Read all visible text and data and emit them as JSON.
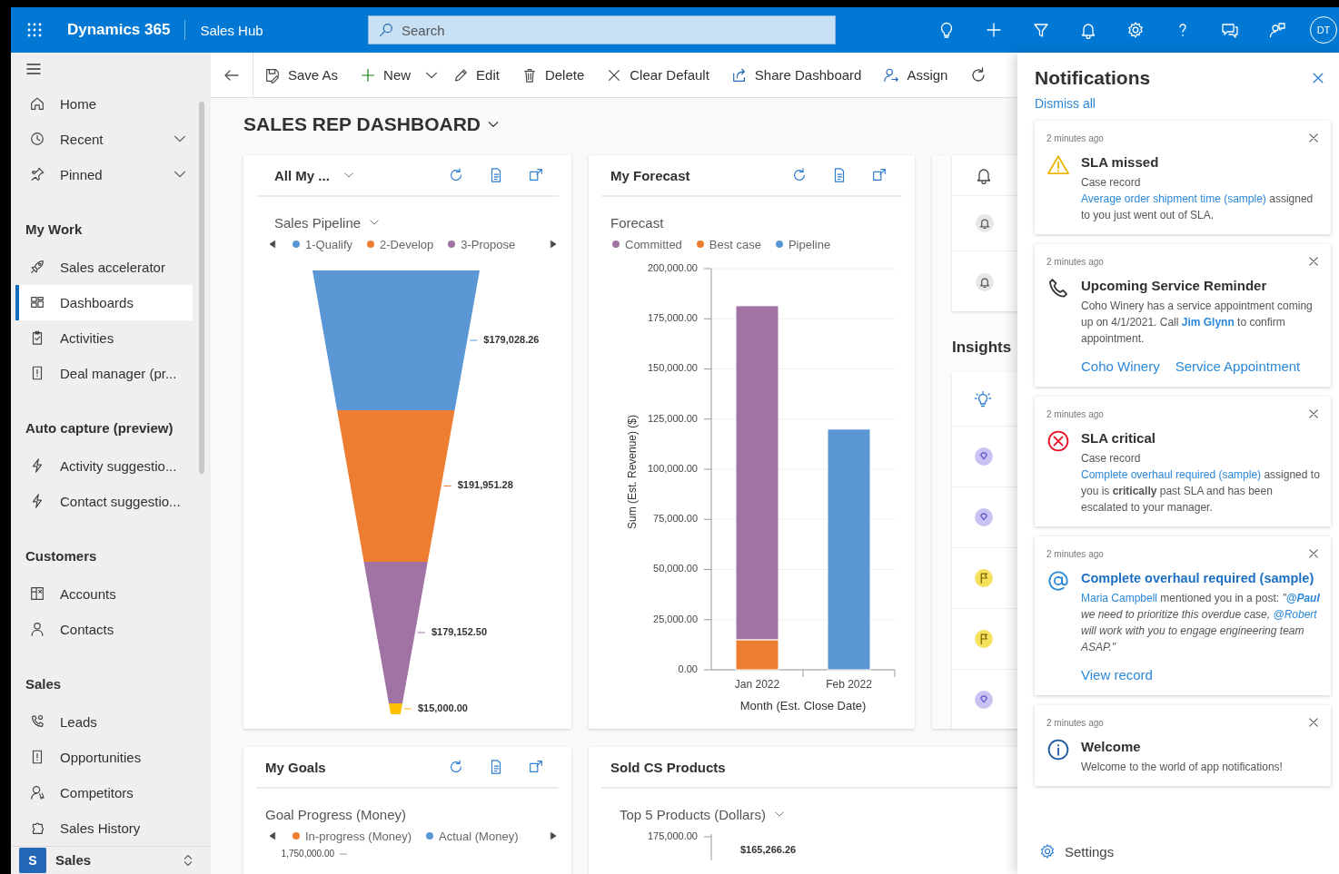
{
  "app_bar": {
    "app_name": "Dynamics 365",
    "area": "Sales Hub",
    "search": {
      "placeholder": "Search"
    },
    "avatar": "DT"
  },
  "nav": {
    "groups": [
      {
        "items": [
          {
            "label": "Home",
            "kind": "link",
            "selected": false
          },
          {
            "label": "Recent",
            "kind": "flyout",
            "selected": false
          },
          {
            "label": "Pinned",
            "kind": "flyout",
            "selected": false
          }
        ]
      },
      {
        "title": "My Work",
        "items": [
          {
            "label": "Sales accelerator",
            "kind": "link",
            "selected": false
          },
          {
            "label": "Dashboards",
            "kind": "link",
            "selected": true
          },
          {
            "label": "Activities",
            "kind": "link",
            "selected": false
          },
          {
            "label": "Deal manager (pr...",
            "kind": "link",
            "selected": false
          }
        ]
      },
      {
        "title": "Auto capture (preview)",
        "items": [
          {
            "label": "Activity suggestio...",
            "kind": "link",
            "selected": false
          },
          {
            "label": "Contact suggestio...",
            "kind": "link",
            "selected": false
          }
        ]
      },
      {
        "title": "Customers",
        "items": [
          {
            "label": "Accounts",
            "kind": "link",
            "selected": false
          },
          {
            "label": "Contacts",
            "kind": "link",
            "selected": false
          }
        ]
      },
      {
        "title": "Sales",
        "items": [
          {
            "label": "Leads",
            "kind": "link",
            "selected": false
          },
          {
            "label": "Opportunities",
            "kind": "link",
            "selected": false
          },
          {
            "label": "Competitors",
            "kind": "link",
            "selected": false
          },
          {
            "label": "Sales History",
            "kind": "link",
            "selected": false
          }
        ]
      }
    ],
    "area_switcher": {
      "badge": "S",
      "label": "Sales"
    }
  },
  "command_bar": [
    {
      "label": "Save As",
      "kind": "button"
    },
    {
      "label": "New",
      "kind": "split"
    },
    {
      "label": "Edit",
      "kind": "button"
    },
    {
      "label": "Delete",
      "kind": "button"
    },
    {
      "label": "Clear Default",
      "kind": "button"
    },
    {
      "label": "Share Dashboard",
      "kind": "button"
    },
    {
      "label": "Assign",
      "kind": "button"
    }
  ],
  "dashboard": {
    "title": "SALES REP DASHBOARD",
    "cards": [
      {
        "kind": "funnel",
        "title": "All My ...",
        "view_menu": true,
        "toolbar": true,
        "chart_title": "Sales Pipeline",
        "chart_menu": true,
        "pager": true,
        "legend": [
          {
            "label": "1-Qualify",
            "color": "#5b97d5"
          },
          {
            "label": "2-Develop",
            "color": "#ed7d31"
          },
          {
            "label": "3-Propose",
            "color": "#a173a5"
          }
        ],
        "segments": [
          {
            "label": "$179,028.26",
            "color": "#5b97d5"
          },
          {
            "label": "$191,951.28",
            "color": "#ed7d31"
          },
          {
            "label": "$179,152.50",
            "color": "#a173a5"
          },
          {
            "label": "$15,000.00",
            "color": "#ffc000"
          }
        ]
      },
      {
        "kind": "bar",
        "title": "My Forecast",
        "view_menu": false,
        "toolbar": true,
        "chart_menu": false,
        "pager": false,
        "chart_data": {
          "type": "bar",
          "title": "Forecast",
          "stacked": true,
          "grid": true,
          "xlabel": "Month (Est. Close Date)",
          "ylabel": "Sum (Est. Revenue) ($)",
          "categories": [
            "Jan 2022",
            "Feb 2022"
          ],
          "series": [
            {
              "name": "Committed",
              "color": "#a173a5",
              "values": [
                166500,
                null
              ]
            },
            {
              "name": "Best case",
              "color": "#ed7d31",
              "values": [
                15000,
                null
              ]
            },
            {
              "name": "Pipeline",
              "color": "#5b97d5",
              "values": [
                null,
                120000
              ]
            }
          ],
          "ylim": [
            0,
            200000
          ],
          "yticks": [
            {
              "value": 0,
              "label": "0.00"
            },
            {
              "value": 25000,
              "label": "25,000.00"
            },
            {
              "value": 50000,
              "label": "50,000.00"
            },
            {
              "value": 75000,
              "label": "75,000.00"
            },
            {
              "value": 100000,
              "label": "100,000.00"
            },
            {
              "value": 125000,
              "label": "125,000.00"
            },
            {
              "value": 150000,
              "label": "150,000.00"
            },
            {
              "value": 175000,
              "label": "175,000.00"
            },
            {
              "value": 200000,
              "label": "200,000.00"
            }
          ]
        }
      },
      {
        "kind": "insights",
        "heading": "Insights",
        "insights": [
          {
            "kind": "diamond"
          },
          {
            "kind": "diamond"
          },
          {
            "kind": "flag"
          },
          {
            "kind": "flag"
          },
          {
            "kind": "diamond"
          }
        ]
      },
      {
        "kind": "goals",
        "title": "My Goals",
        "view_menu": false,
        "toolbar": true,
        "chart_title": "Goal Progress (Money)",
        "chart_menu": false,
        "pager": true,
        "legend": [
          {
            "label": "In-progress (Money)",
            "color": "#ed7d31"
          },
          {
            "label": "Actual (Money)",
            "color": "#5b97d5"
          }
        ],
        "axis_tick": "1,750,000.00"
      },
      {
        "kind": "products",
        "title": "Sold CS Products",
        "view_menu": false,
        "toolbar": false,
        "chart_title": "Top 5 Products (Dollars)",
        "chart_menu": true,
        "axis_tick": "175,000.00",
        "value_label": "$165,266.26"
      }
    ]
  },
  "notifications": {
    "title": "Notifications",
    "dismiss_all": "Dismiss all",
    "items": [
      {
        "kind": "warning",
        "time": "2 minutes ago",
        "title": "SLA missed",
        "title_link": false,
        "message": [
          {
            "text": "Case record ",
            "link": false,
            "quote": false
          },
          {
            "text": "Average order shipment time (sample)",
            "link": true,
            "quote": false
          },
          {
            "text": " assigned to you just went out of SLA.",
            "link": false,
            "quote": false
          }
        ]
      },
      {
        "kind": "phone",
        "time": "2 minutes ago",
        "title": "Upcoming Service Reminder",
        "title_link": false,
        "message": [
          {
            "text": "Coho Winery has a service appointment coming up on 4/1/2021. Call ",
            "link": false,
            "quote": false
          },
          {
            "text": "**Jim Glynn**",
            "link": true,
            "quote": false
          },
          {
            "text": " to confirm appointment.",
            "link": false,
            "quote": false
          }
        ],
        "actions": [
          "Coho Winery",
          "Service Appointment"
        ]
      },
      {
        "kind": "error",
        "time": "2 minutes ago",
        "title": "SLA critical",
        "title_link": false,
        "message": [
          {
            "text": "Case record ",
            "link": false,
            "quote": false
          },
          {
            "text": "Complete overhaul required (sample)",
            "link": true,
            "quote": false
          },
          {
            "text": " assigned to you is **critically** past SLA and has been escalated to your manager.",
            "link": false,
            "quote": false
          }
        ]
      },
      {
        "kind": "mention",
        "time": "2 minutes ago",
        "title": "Complete overhaul required (sample)",
        "title_link": true,
        "message": [
          {
            "text": "Maria Campbell",
            "link": true,
            "quote": false
          },
          {
            "text": " mentioned you in a post: ",
            "link": false,
            "quote": false
          },
          {
            "text": "\"",
            "link": false,
            "quote": true
          },
          {
            "text": "**@Paul**",
            "link": true,
            "quote": true
          },
          {
            "text": " we need to prioritize this overdue case, ",
            "link": false,
            "quote": true
          },
          {
            "text": "@Robert",
            "link": true,
            "quote": true
          },
          {
            "text": " will work with you to engage engineering team ASAP.\"",
            "link": false,
            "quote": true
          }
        ],
        "actions": [
          "View record"
        ]
      },
      {
        "kind": "info",
        "time": "2 minutes ago",
        "title": "Welcome",
        "title_link": false,
        "message": [
          {
            "text": "Welcome to the world of app notifications!",
            "link": false,
            "quote": false
          }
        ]
      }
    ],
    "settings": "Settings"
  }
}
